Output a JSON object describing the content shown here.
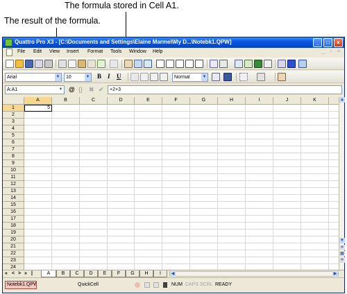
{
  "callouts": {
    "formula_stored": "The formula stored in Cell A1.",
    "formula_result": "The result of the formula."
  },
  "window": {
    "title": "Quattro Pro X3 - [C:\\Documents and Settings\\Elaine Marmel\\My D...\\Notebk1.QPW]",
    "minimize": "_",
    "maximize": "□",
    "close": "×"
  },
  "menu": [
    "File",
    "Edit",
    "View",
    "Insert",
    "Format",
    "Tools",
    "Window",
    "Help"
  ],
  "toolbar": {
    "font_name": "Arial",
    "font_size": "10",
    "bold": "B",
    "italic": "I",
    "underline": "U",
    "style": "Normal"
  },
  "formula_bar": {
    "cell_ref": "A:A1",
    "at_symbol": "@",
    "braces": "{}",
    "cancel": "✖",
    "accept": "✔",
    "formula": "+2+3"
  },
  "grid": {
    "columns": [
      "A",
      "B",
      "C",
      "D",
      "E",
      "F",
      "G",
      "H",
      "I",
      "J",
      "K"
    ],
    "rows": [
      "1",
      "2",
      "3",
      "4",
      "5",
      "6",
      "7",
      "8",
      "9",
      "10",
      "11",
      "12",
      "13",
      "14",
      "15",
      "16",
      "17",
      "18",
      "19",
      "20",
      "21",
      "22",
      "23",
      "24"
    ],
    "a1_value": "5"
  },
  "sheet_tabs": {
    "nav": [
      "«",
      "<",
      ">",
      "»",
      "|"
    ],
    "tabs": [
      "A",
      "B",
      "C",
      "D",
      "E",
      "F",
      "G",
      "H",
      "I"
    ]
  },
  "status": {
    "notebook": "Notebk1.QPW",
    "quickcell": "QuickCell",
    "num": "NUM",
    "caps": "CAPS",
    "scrl": "SCRL",
    "mode": "READY"
  }
}
